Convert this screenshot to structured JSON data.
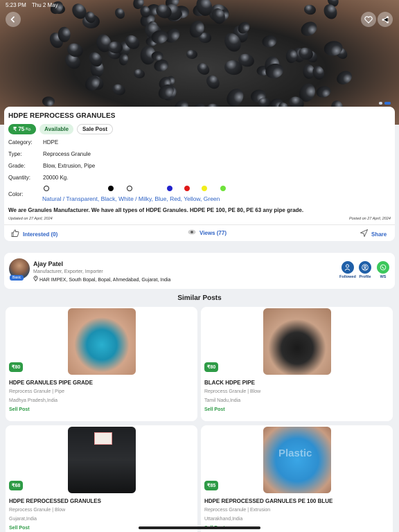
{
  "status_bar": {
    "time": "5:23 PM",
    "date": "Thu 2 May"
  },
  "product": {
    "title": "HDPE REPROCESS GRANULES",
    "price": "₹ 75",
    "price_unit": "/Kg.",
    "availability": "Available",
    "post_type": "Sale Post",
    "details": [
      {
        "key": "Category:",
        "value": "HDPE"
      },
      {
        "key": "Type:",
        "value": "Reprocess Granule"
      },
      {
        "key": "Grade:",
        "value": "Blow, Extrusion, Pipe"
      },
      {
        "key": "Quantity:",
        "value": "20000 Kg."
      }
    ],
    "color_label": "Color:",
    "colors": [
      {
        "name": "Natural / Transparent",
        "hex": "#ffffff"
      },
      {
        "name": "Black",
        "hex": "#000000"
      },
      {
        "name": "White / Milky",
        "hex": "#ffffff"
      },
      {
        "name": "Blue",
        "hex": "#2222cc"
      },
      {
        "name": "Red",
        "hex": "#e01818"
      },
      {
        "name": "Yellow",
        "hex": "#f2ee1a"
      },
      {
        "name": "Green",
        "hex": "#6ee23a"
      }
    ],
    "color_names": "Natural / Transparent,  Black,  White / Milky,  Blue,  Red,  Yellow,  Green",
    "description": "We are Granules Manufacturer. We have all types of HDPE Granules. HDPE PE 100, PE 80, PE 63 any pipe grade.",
    "updated": "Updated on 27 April, 2024",
    "posted": "Posted on 27 April, 2024",
    "interested": "Interested (0)",
    "views": "Views (77)",
    "share": "Share"
  },
  "seller": {
    "name": "Ajay Patel",
    "badge": "Basic",
    "roles": "Manufacturer, Exporter, Importer",
    "address": "HAR IMPEX, South Bopal, Bopal, Ahmedabad, Gujarat, India",
    "actions": [
      "Followed",
      "Profile",
      "WS"
    ]
  },
  "similar_title": "Similar Posts",
  "similar": [
    {
      "price": "₹80",
      "name": "HDPE GRANULES PIPE GRADE",
      "category": "Reprocess Granule | Pipe",
      "location": "Madhya Pradesh,India",
      "type": "Sell Post"
    },
    {
      "price": "₹80",
      "name": "BLACK HDPE PIPE",
      "category": "Reprocess Granule | Blow",
      "location": "Tamil Nadu,India",
      "type": "Sell Post"
    },
    {
      "price": "₹68",
      "name": "HDPE  REPROCESSED GRANULES",
      "category": "Reprocess Granule | Blow",
      "location": "Gujarat,India",
      "type": "Sell Post"
    },
    {
      "price": "₹85",
      "name": "HDPE REPROCESSED GARNULES PE 100 BLUE",
      "category": "Reprocess Granule | Extrusion",
      "location": "Uttarakhand,India",
      "type": "Sell Post",
      "watermark": "Plastic"
    }
  ],
  "colors": {
    "accent_green": "#2e9b46",
    "link_blue": "#2f63c5",
    "primary_blue": "#2f6fd6",
    "whatsapp": "#3cc85c"
  }
}
